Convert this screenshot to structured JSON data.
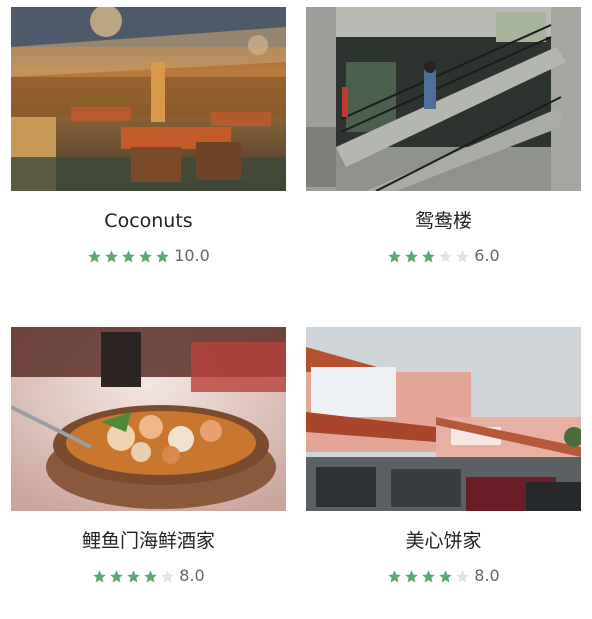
{
  "colors": {
    "star_filled": "#5ca870",
    "star_empty": "#e3e3e3",
    "name_text": "#222222",
    "score_text": "#666666"
  },
  "restaurants": [
    {
      "name": "Coconuts",
      "score": "10.0",
      "rating_stars": 5,
      "photo": "restaurant-interior-photo"
    },
    {
      "name": "鸳鸯楼",
      "score": "6.0",
      "rating_stars": 3,
      "photo": "concrete-stairway-photo"
    },
    {
      "name": "鲤鱼门海鲜酒家",
      "score": "8.0",
      "rating_stars": 4,
      "photo": "seafood-clay-pot-photo"
    },
    {
      "name": "美心饼家",
      "score": "8.0",
      "rating_stars": 4,
      "photo": "storefront-building-photo"
    }
  ]
}
